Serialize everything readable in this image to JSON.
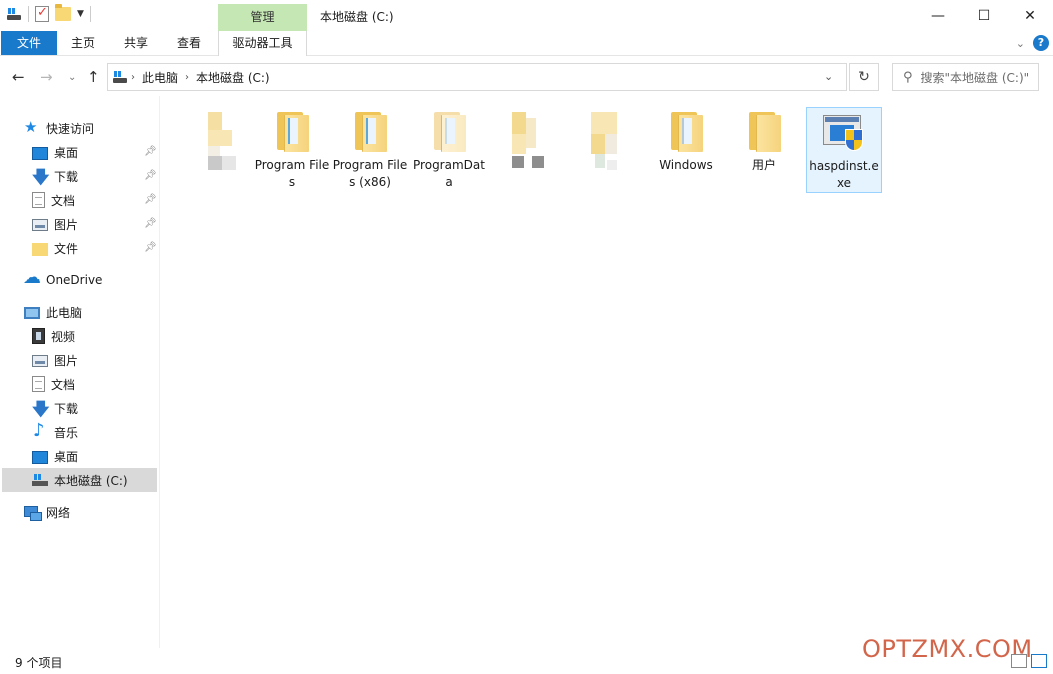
{
  "window": {
    "title": "本地磁盘 (C:)",
    "context_tab": "管理",
    "minimize": "—",
    "maximize": "☐",
    "close": "✕"
  },
  "ribbon": {
    "tabs": [
      "文件",
      "主页",
      "共享",
      "查看",
      "驱动器工具"
    ],
    "accent_color": "#1979ca",
    "context_color": "#c4e7b3"
  },
  "address": {
    "crumbs": [
      "此电脑",
      "本地磁盘 (C:)"
    ],
    "search_placeholder": "搜索\"本地磁盘 (C:)\""
  },
  "sidebar": {
    "quick_access": "快速访问",
    "quick_items": [
      {
        "label": "桌面",
        "icon": "desktop-icon"
      },
      {
        "label": "下载",
        "icon": "download-icon"
      },
      {
        "label": "文档",
        "icon": "document-icon"
      },
      {
        "label": "图片",
        "icon": "pictures-icon"
      },
      {
        "label": "文件",
        "icon": "folder-icon"
      }
    ],
    "onedrive": "OneDrive",
    "this_pc": "此电脑",
    "pc_items": [
      {
        "label": "视频",
        "icon": "video-icon"
      },
      {
        "label": "图片",
        "icon": "pictures-icon"
      },
      {
        "label": "文档",
        "icon": "document-icon"
      },
      {
        "label": "下载",
        "icon": "download-icon"
      },
      {
        "label": "音乐",
        "icon": "music-icon"
      },
      {
        "label": "桌面",
        "icon": "desktop-icon"
      },
      {
        "label": "本地磁盘 (C:)",
        "icon": "drive-icon"
      }
    ],
    "network": "网络"
  },
  "files": [
    {
      "label": "",
      "kind": "blurred"
    },
    {
      "label": "Program Files",
      "kind": "folder"
    },
    {
      "label": "Program Files (x86)",
      "kind": "folder"
    },
    {
      "label": "ProgramData",
      "kind": "folder-light"
    },
    {
      "label": "",
      "kind": "blurred"
    },
    {
      "label": "",
      "kind": "blurred"
    },
    {
      "label": "Windows",
      "kind": "folder"
    },
    {
      "label": "用户",
      "kind": "folder"
    },
    {
      "label": "haspdinst.exe",
      "kind": "exe"
    }
  ],
  "status": {
    "count": "9 个项目",
    "watermark": "OPTZMX.COM"
  }
}
